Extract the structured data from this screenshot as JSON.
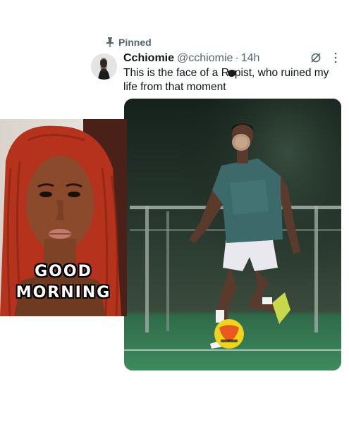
{
  "tweet": {
    "pinned_label": "Pinned",
    "display_name": "Cchiomie",
    "handle": "@cchiomie",
    "separator": "·",
    "time": "14h",
    "text_line1_before": "This is the face of a R",
    "text_line1_after": "pist, who ruined my",
    "text_line2": "life from that moment"
  },
  "images": {
    "post_photo": "football-player-photo",
    "selfie_photo": "woman-selfie-photo"
  },
  "overlay": {
    "caption_line1": "GOOD",
    "caption_line2": "MORNING"
  },
  "icons": {
    "pin": "pin-icon",
    "grok": "grok-icon",
    "more": "more-icon"
  },
  "colors": {
    "secondary_text": "#536471",
    "primary_text": "#0f1419",
    "jersey": "#3c6a6b",
    "hair": "#b5331c"
  }
}
